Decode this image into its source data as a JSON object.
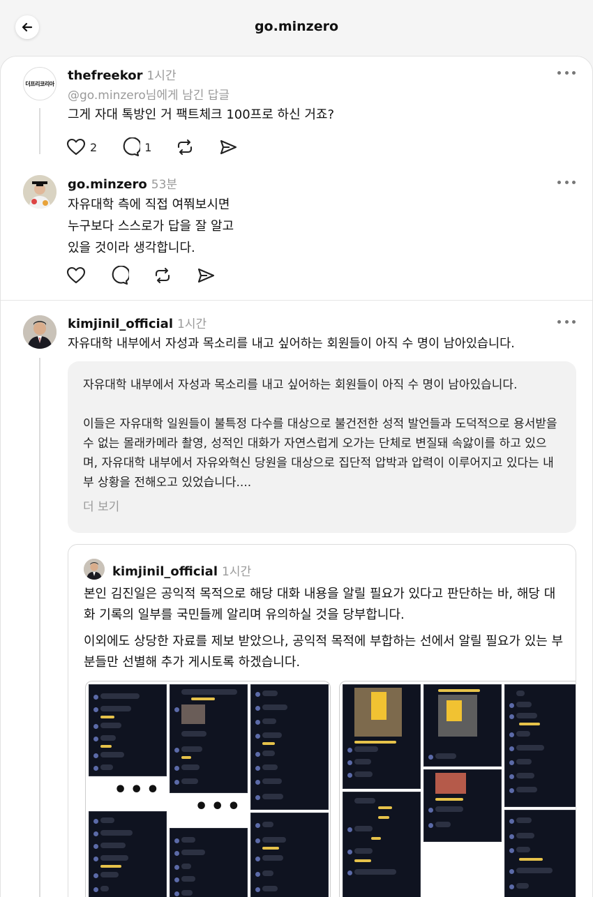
{
  "header": {
    "title": "go.minzero"
  },
  "posts": [
    {
      "username": "thefreekor",
      "time": "1시간",
      "avatar_text": "더프리코리아",
      "reply_to": "@go.minzero님에게 남긴 답글",
      "text": "그게 자대 톡방인 거 팩트체크 100프로 하신 거죠?",
      "likes": "2",
      "comments": "1"
    },
    {
      "username": "go.minzero",
      "time": "53분",
      "text": "자유대학 측에 직접 여쭤보시면\n누구보다 스스로가 답을 잘 알고\n있을 것이라 생각합니다."
    },
    {
      "username": "kimjinil_official",
      "time": "1시간",
      "text": "자유대학 내부에서 자성과 목소리를 내고 싶어하는 회원들이 아직 수 명이 남아있습니다.",
      "quote": "자유대학 내부에서 자성과 목소리를 내고 싶어하는 회원들이 아직 수 명이 남아있습니다.\n\n이들은 자유대학 일원들이 불특정 다수를 대상으로 불건전한 성적 발언들과 도덕적으로 용서받을 수 없는 몰래카메라 촬영, 성적인 대화가 자연스럽게 오가는 단체로 변질돼 속앓이를 하고 있으며, 자유대학 내부에서 자유와혁신 당원을 대상으로 집단적 압박과 압력이 이루어지고 있다는 내부 상황을 전해오고 있었습니다....",
      "see_more": "더 보기",
      "embed": {
        "username": "kimjinil_official",
        "time": "1시간",
        "p1": "본인 김진일은 공익적 목적으로 해당 대화 내용을 알릴 필요가 있다고 판단하는 바, 해당 대화 기록의 일부를 국민들께 알리며 유의하실 것을 당부합니다.",
        "p2": "이외에도 상당한 자료를 제보 받았으나, 공익적 목적에 부합하는 선에서 알릴 필요가 있는 부분들만 선별해 추가 게시토록 하겠습니다.",
        "ellipsis": "•••"
      }
    }
  ],
  "colors": {
    "blur_highlight": "#f1c232",
    "chat_bg": "#0f1320",
    "muted_text": "#9a9a9a"
  }
}
